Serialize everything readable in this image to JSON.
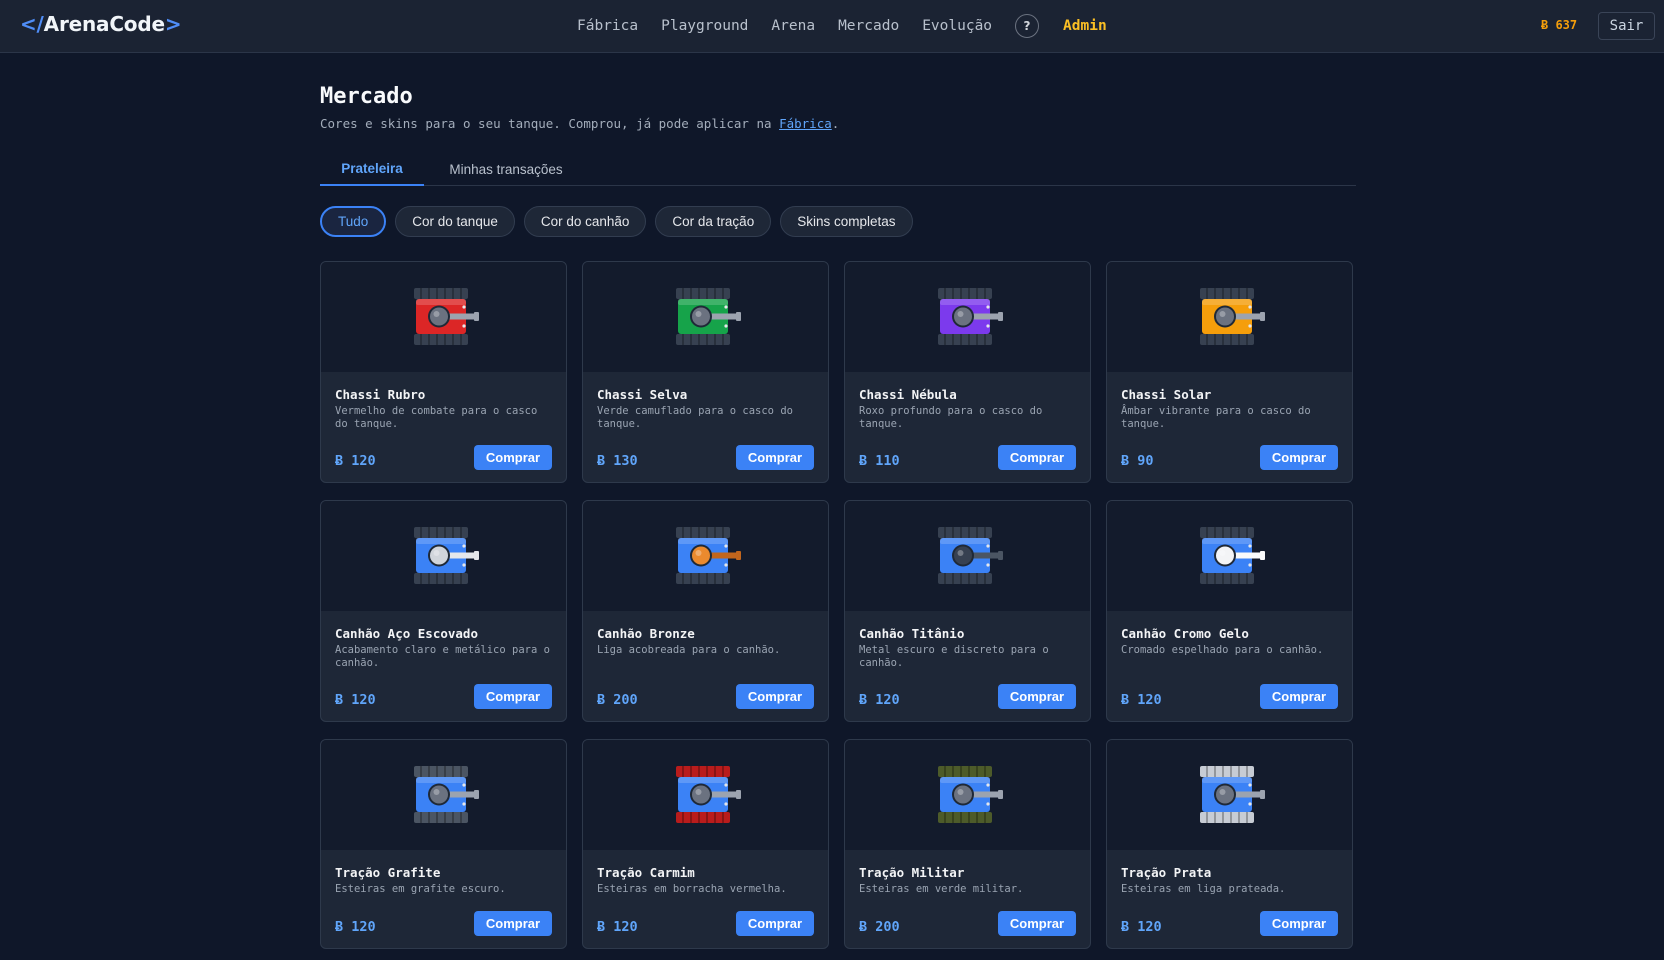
{
  "brand": {
    "prefix": "</",
    "name": "ArenaCode",
    "suffix": ">"
  },
  "nav": [
    {
      "label": "Fábrica"
    },
    {
      "label": "Playground"
    },
    {
      "label": "Arena"
    },
    {
      "label": "Mercado"
    },
    {
      "label": "Evolução"
    }
  ],
  "help_label": "?",
  "admin_label": "Admin",
  "balance": "Ƀ 637",
  "logout_label": "Sair",
  "page": {
    "title": "Mercado",
    "subtitle_before": "Cores e skins para o seu tanque. Comprou, já pode aplicar na ",
    "subtitle_link": "Fábrica",
    "subtitle_after": "."
  },
  "tabs": [
    {
      "label": "Prateleira",
      "active": true
    },
    {
      "label": "Minhas transações",
      "active": false
    }
  ],
  "filters": [
    {
      "label": "Tudo",
      "active": true
    },
    {
      "label": "Cor do tanque",
      "active": false
    },
    {
      "label": "Cor do canhão",
      "active": false
    },
    {
      "label": "Cor da tração",
      "active": false
    },
    {
      "label": "Skins completas",
      "active": false
    }
  ],
  "buy_label": "Comprar",
  "items": [
    {
      "name": "Chassi Rubro",
      "desc": "Vermelho de combate para o casco do tanque.",
      "price": "Ƀ 120",
      "colors": {
        "hull": "#dc2626",
        "turret": "#6b7280",
        "track": "#374151",
        "barrel": "#9ca3af"
      }
    },
    {
      "name": "Chassi Selva",
      "desc": "Verde camuflado para o casco do tanque.",
      "price": "Ƀ 130",
      "colors": {
        "hull": "#16a34a",
        "turret": "#6b7280",
        "track": "#374151",
        "barrel": "#9ca3af"
      }
    },
    {
      "name": "Chassi Nébula",
      "desc": "Roxo profundo para o casco do tanque.",
      "price": "Ƀ 110",
      "colors": {
        "hull": "#7c3aed",
        "turret": "#6b7280",
        "track": "#374151",
        "barrel": "#9ca3af"
      }
    },
    {
      "name": "Chassi Solar",
      "desc": "Âmbar vibrante para o casco do tanque.",
      "price": "Ƀ 90",
      "colors": {
        "hull": "#f59e0b",
        "turret": "#6b7280",
        "track": "#374151",
        "barrel": "#9ca3af"
      }
    },
    {
      "name": "Canhão Aço Escovado",
      "desc": "Acabamento claro e metálico para o canhão.",
      "price": "Ƀ 120",
      "colors": {
        "hull": "#3b82f6",
        "turret": "#d1d5db",
        "track": "#374151",
        "barrel": "#e5e7eb"
      }
    },
    {
      "name": "Canhão Bronze",
      "desc": "Liga acobreada para o canhão.",
      "price": "Ƀ 200",
      "colors": {
        "hull": "#3b82f6",
        "turret": "#ea8a2e",
        "track": "#374151",
        "barrel": "#c2661d"
      }
    },
    {
      "name": "Canhão Titânio",
      "desc": "Metal escuro e discreto para o canhão.",
      "price": "Ƀ 120",
      "colors": {
        "hull": "#3b82f6",
        "turret": "#374151",
        "track": "#374151",
        "barrel": "#4b5563"
      }
    },
    {
      "name": "Canhão Cromo Gelo",
      "desc": "Cromado espelhado para o canhão.",
      "price": "Ƀ 120",
      "colors": {
        "hull": "#3b82f6",
        "turret": "#f3f4f6",
        "track": "#374151",
        "barrel": "#f9fafb"
      }
    },
    {
      "name": "Tração Grafite",
      "desc": "Esteiras em grafite escuro.",
      "price": "Ƀ 120",
      "colors": {
        "hull": "#3b82f6",
        "turret": "#6b7280",
        "track": "#4b5563",
        "barrel": "#9ca3af"
      }
    },
    {
      "name": "Tração Carmim",
      "desc": "Esteiras em borracha vermelha.",
      "price": "Ƀ 120",
      "colors": {
        "hull": "#3b82f6",
        "turret": "#6b7280",
        "track": "#b91c1c",
        "barrel": "#9ca3af"
      }
    },
    {
      "name": "Tração Militar",
      "desc": "Esteiras em verde militar.",
      "price": "Ƀ 200",
      "colors": {
        "hull": "#3b82f6",
        "turret": "#6b7280",
        "track": "#4d5b2a",
        "barrel": "#9ca3af"
      }
    },
    {
      "name": "Tração Prata",
      "desc": "Esteiras em liga prateada.",
      "price": "Ƀ 120",
      "colors": {
        "hull": "#3b82f6",
        "turret": "#6b7280",
        "track": "#c7ccd4",
        "barrel": "#9ca3af"
      }
    }
  ]
}
